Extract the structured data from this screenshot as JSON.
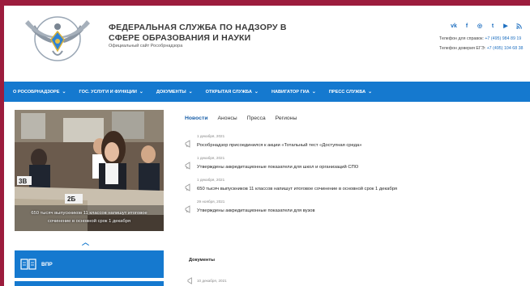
{
  "header": {
    "title_line1": "ФЕДЕРАЛЬНАЯ СЛУЖБА ПО НАДЗОРУ В",
    "title_line2": "СФЕРЕ ОБРАЗОВАНИЯ И НАУКИ",
    "subtitle": "Официальный сайт Рособрнадзора",
    "social": [
      "vk",
      "f",
      "◎",
      "t",
      "▶",
      "rss"
    ],
    "contact1_label": "Телефон для справок: ",
    "contact1_phone": "+7 (495) 984 89 19",
    "contact2_label": "Телефон доверия ЕГЭ: ",
    "contact2_phone": "+7 (495) 104 68 38"
  },
  "nav": [
    "О РОСОБРНАДЗОРЕ",
    "ГОС. УСЛУГИ И ФУНКЦИИ",
    "ДОКУМЕНТЫ",
    "ОТКРЫТАЯ СЛУЖБА",
    "НАВИГАТОР ГИА",
    "ПРЕСС СЛУЖБА"
  ],
  "hero": {
    "caption": "650 тысяч выпускников 11 классов напишут итоговое сочинение в основной срок 1 декабря",
    "desk_labels": [
      "3В",
      "2Б"
    ]
  },
  "vpr_label": "ВПР",
  "tabs": [
    "Новости",
    "Анонсы",
    "Пресса",
    "Регионы"
  ],
  "news": [
    {
      "date": "1 декабря, 2021",
      "title": "Рособрнадзор присоединился к акции «Тотальный тест «Доступная среда»"
    },
    {
      "date": "1 декабря, 2021",
      "title": "Утверждены аккредитационные показатели для школ и организаций СПО"
    },
    {
      "date": "1 декабря, 2021",
      "title": "650 тысяч выпускников 11 классов напишут итоговое сочинение в основной срок 1 декабря"
    },
    {
      "date": "29 ноября, 2021",
      "title": "Утверждены аккредитационные показатели для вузов"
    }
  ],
  "documents": {
    "heading": "Документы",
    "first_date": "10 декабря, 2021"
  },
  "colors": {
    "nav_bg": "#1579cf",
    "frame_bg": "#9c1c3d",
    "link": "#1e6fc0"
  }
}
